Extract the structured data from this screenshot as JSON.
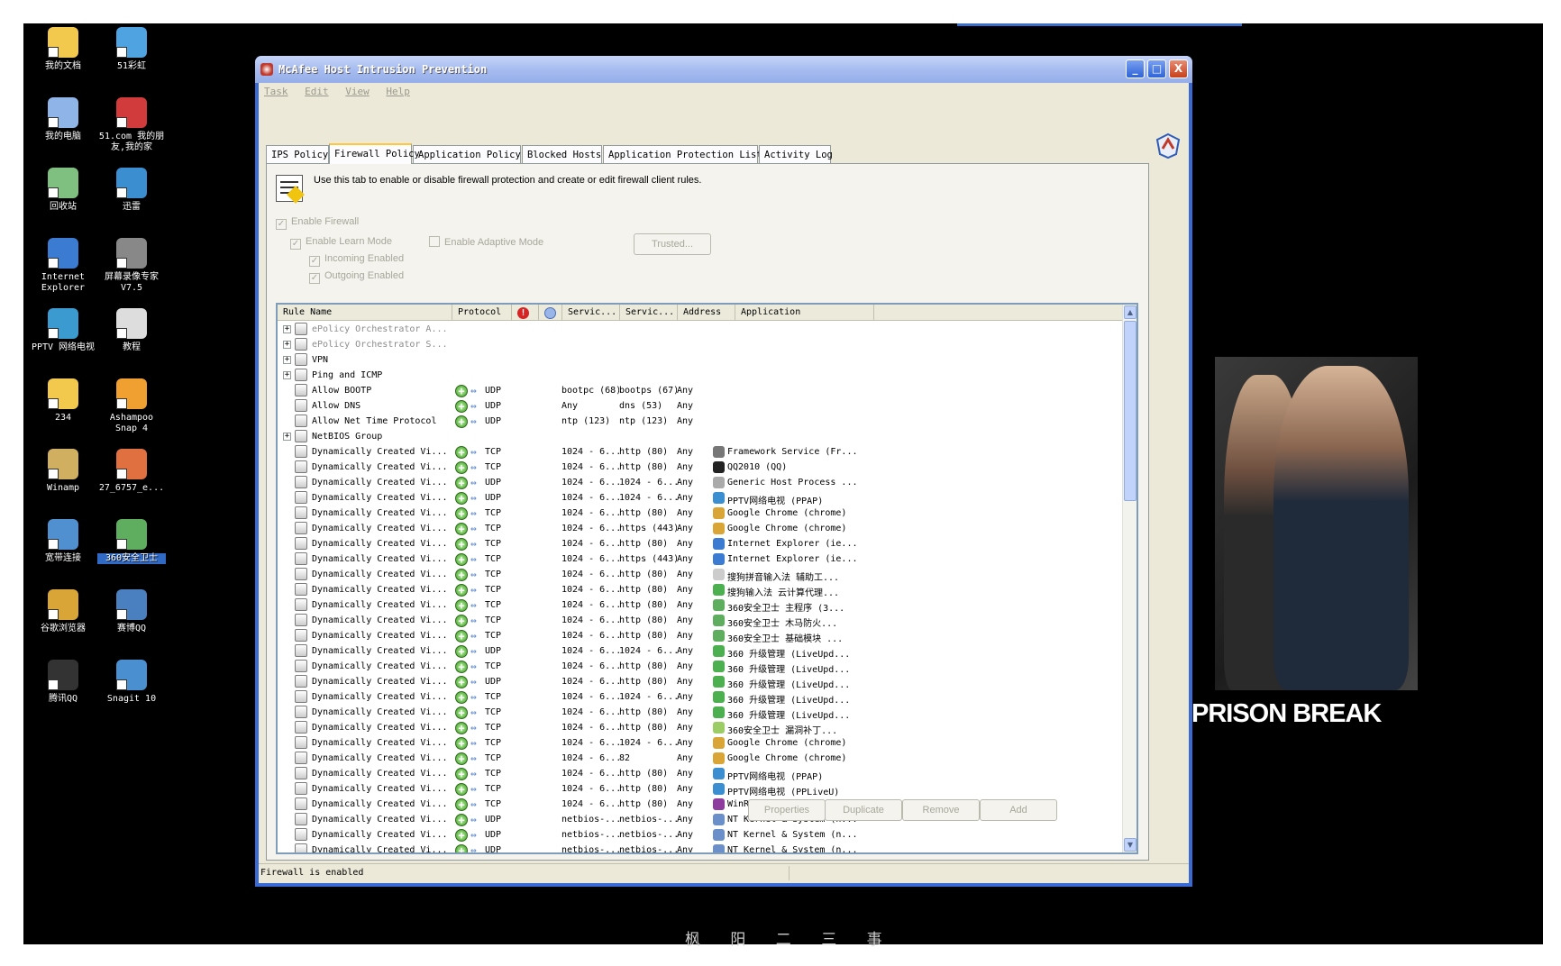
{
  "desktop": {
    "icons": [
      {
        "label": "我的文档",
        "color": "#f2c94c"
      },
      {
        "label": "51彩虹",
        "color": "#4fa3e0"
      },
      {
        "label": "我的电脑",
        "color": "#8fb4e8"
      },
      {
        "label": "51.com 我的朋友,我的家",
        "color": "#d13b3b"
      },
      {
        "label": "回收站",
        "color": "#7fbf7f"
      },
      {
        "label": "迅雷",
        "color": "#3b8fd1"
      },
      {
        "label": "Internet Explorer",
        "color": "#3b7bd1"
      },
      {
        "label": "屏幕录像专家 V7.5",
        "color": "#888888"
      },
      {
        "label": "PPTV 网络电视",
        "color": "#3b9bd1"
      },
      {
        "label": "教程",
        "color": "#dddddd"
      },
      {
        "label": "234",
        "color": "#f2c94c"
      },
      {
        "label": "Ashampoo Snap 4",
        "color": "#f0a030"
      },
      {
        "label": "Winamp",
        "color": "#d0b060"
      },
      {
        "label": "27_6757_e...",
        "color": "#e07040"
      },
      {
        "label": "宽带连接",
        "color": "#5090d0"
      },
      {
        "label": "360安全卫士",
        "color": "#5fae5f"
      },
      {
        "label": "谷歌浏览器",
        "color": "#d9a536"
      },
      {
        "label": "赛博QQ",
        "color": "#4a7fc0"
      },
      {
        "label": "腾讯QQ",
        "color": "#333333"
      },
      {
        "label": "Snagit 10",
        "color": "#4a8fd0"
      }
    ],
    "poster_title": "PRISON BREAK",
    "watermark": "枫 阳 二 三 事"
  },
  "window": {
    "title": "McAfee Host Intrusion Prevention",
    "buttons": {
      "minimize": "_",
      "maximize": "□",
      "close": "X"
    },
    "menu": [
      "Task",
      "Edit",
      "View",
      "Help"
    ],
    "tabs": [
      "IPS Policy",
      "Firewall Policy",
      "Application Policy",
      "Blocked Hosts",
      "Application Protection List",
      "Activity Log"
    ],
    "active_tab": "Firewall Policy",
    "description": "Use this tab to enable or disable firewall protection and create or edit firewall client rules.",
    "options": {
      "enable_firewall": "Enable Firewall",
      "enable_learn_mode": "Enable Learn Mode",
      "enable_adaptive_mode": "Enable Adaptive Mode",
      "incoming_enabled": "Incoming Enabled",
      "outgoing_enabled": "Outgoing Enabled",
      "trusted_button": "Trusted..."
    },
    "columns": [
      "Rule Name",
      "Protocol",
      "",
      "",
      "Servic...",
      "Servic...",
      "Address",
      "Application"
    ],
    "rows": [
      {
        "name": "ePolicy Orchestrator A...",
        "group": true,
        "grey": true,
        "protocol": "",
        "svc1": "",
        "svc2": "",
        "addr": "",
        "app": ""
      },
      {
        "name": "ePolicy Orchestrator S...",
        "group": true,
        "grey": true,
        "protocol": "",
        "svc1": "",
        "svc2": "",
        "addr": "",
        "app": ""
      },
      {
        "name": "VPN",
        "group": true,
        "grey": false,
        "protocol": "",
        "svc1": "",
        "svc2": "",
        "addr": "",
        "app": ""
      },
      {
        "name": "Ping and ICMP",
        "group": true,
        "grey": false,
        "protocol": "",
        "svc1": "",
        "svc2": "",
        "addr": "",
        "app": ""
      },
      {
        "name": "Allow BOOTP",
        "group": false,
        "grey": false,
        "protocol": "UDP",
        "svc1": "bootpc (68)",
        "svc2": "bootps (67)",
        "addr": "Any",
        "app": ""
      },
      {
        "name": "Allow DNS",
        "group": false,
        "grey": false,
        "protocol": "UDP",
        "svc1": "Any",
        "svc2": "dns (53)",
        "addr": "Any",
        "app": ""
      },
      {
        "name": "Allow Net Time Protocol",
        "group": false,
        "grey": false,
        "protocol": "UDP",
        "svc1": "ntp (123)",
        "svc2": "ntp (123)",
        "addr": "Any",
        "app": ""
      },
      {
        "name": "NetBIOS Group",
        "group": true,
        "grey": false,
        "protocol": "",
        "svc1": "",
        "svc2": "",
        "addr": "",
        "app": ""
      },
      {
        "name": "Dynamically Created Vi...",
        "group": false,
        "grey": false,
        "protocol": "TCP",
        "svc1": "1024 - 6...",
        "svc2": "http (80)",
        "addr": "Any",
        "app": "Framework Service (Fr...",
        "app_color": "#777777"
      },
      {
        "name": "Dynamically Created Vi...",
        "group": false,
        "grey": false,
        "protocol": "TCP",
        "svc1": "1024 - 6...",
        "svc2": "http (80)",
        "addr": "Any",
        "app": "QQ2010 (QQ)",
        "app_color": "#222222"
      },
      {
        "name": "Dynamically Created Vi...",
        "group": false,
        "grey": false,
        "protocol": "UDP",
        "svc1": "1024 - 6...",
        "svc2": "1024 - 6...",
        "addr": "Any",
        "app": "Generic Host Process ...",
        "app_color": "#aaaaaa"
      },
      {
        "name": "Dynamically Created Vi...",
        "group": false,
        "grey": false,
        "protocol": "UDP",
        "svc1": "1024 - 6...",
        "svc2": "1024 - 6...",
        "addr": "Any",
        "app": "PPTV网络电视 (PPAP)",
        "app_color": "#3b8fd1"
      },
      {
        "name": "Dynamically Created Vi...",
        "group": false,
        "grey": false,
        "protocol": "TCP",
        "svc1": "1024 - 6...",
        "svc2": "http (80)",
        "addr": "Any",
        "app": "Google Chrome (chrome)",
        "app_color": "#d9a536"
      },
      {
        "name": "Dynamically Created Vi...",
        "group": false,
        "grey": false,
        "protocol": "TCP",
        "svc1": "1024 - 6...",
        "svc2": "https (443)",
        "addr": "Any",
        "app": "Google Chrome (chrome)",
        "app_color": "#d9a536"
      },
      {
        "name": "Dynamically Created Vi...",
        "group": false,
        "grey": false,
        "protocol": "TCP",
        "svc1": "1024 - 6...",
        "svc2": "http (80)",
        "addr": "Any",
        "app": "Internet Explorer (ie...",
        "app_color": "#3b7bd1"
      },
      {
        "name": "Dynamically Created Vi...",
        "group": false,
        "grey": false,
        "protocol": "TCP",
        "svc1": "1024 - 6...",
        "svc2": "https (443)",
        "addr": "Any",
        "app": "Internet Explorer (ie...",
        "app_color": "#3b7bd1"
      },
      {
        "name": "Dynamically Created Vi...",
        "group": false,
        "grey": false,
        "protocol": "TCP",
        "svc1": "1024 - 6...",
        "svc2": "http (80)",
        "addr": "Any",
        "app": "搜狗拼音输入法 辅助工...",
        "app_color": "#cccccc"
      },
      {
        "name": "Dynamically Created Vi...",
        "group": false,
        "grey": false,
        "protocol": "TCP",
        "svc1": "1024 - 6...",
        "svc2": "http (80)",
        "addr": "Any",
        "app": "搜狗输入法 云计算代理...",
        "app_color": "#4caf50"
      },
      {
        "name": "Dynamically Created Vi...",
        "group": false,
        "grey": false,
        "protocol": "TCP",
        "svc1": "1024 - 6...",
        "svc2": "http (80)",
        "addr": "Any",
        "app": "360安全卫士 主程序 (3...",
        "app_color": "#5fae5f"
      },
      {
        "name": "Dynamically Created Vi...",
        "group": false,
        "grey": false,
        "protocol": "TCP",
        "svc1": "1024 - 6...",
        "svc2": "http (80)",
        "addr": "Any",
        "app": "360安全卫士 木马防火...",
        "app_color": "#5fae5f"
      },
      {
        "name": "Dynamically Created Vi...",
        "group": false,
        "grey": false,
        "protocol": "TCP",
        "svc1": "1024 - 6...",
        "svc2": "http (80)",
        "addr": "Any",
        "app": "360安全卫士 基础模块 ...",
        "app_color": "#5fae5f"
      },
      {
        "name": "Dynamically Created Vi...",
        "group": false,
        "grey": false,
        "protocol": "UDP",
        "svc1": "1024 - 6...",
        "svc2": "1024 - 6...",
        "addr": "Any",
        "app": "360 升级管理 (LiveUpd...",
        "app_color": "#4caf50"
      },
      {
        "name": "Dynamically Created Vi...",
        "group": false,
        "grey": false,
        "protocol": "TCP",
        "svc1": "1024 - 6...",
        "svc2": "http (80)",
        "addr": "Any",
        "app": "360 升级管理 (LiveUpd...",
        "app_color": "#4caf50"
      },
      {
        "name": "Dynamically Created Vi...",
        "group": false,
        "grey": false,
        "protocol": "UDP",
        "svc1": "1024 - 6...",
        "svc2": "http (80)",
        "addr": "Any",
        "app": "360 升级管理 (LiveUpd...",
        "app_color": "#4caf50"
      },
      {
        "name": "Dynamically Created Vi...",
        "group": false,
        "grey": false,
        "protocol": "TCP",
        "svc1": "1024 - 6...",
        "svc2": "1024 - 6...",
        "addr": "Any",
        "app": "360 升级管理 (LiveUpd...",
        "app_color": "#4caf50"
      },
      {
        "name": "Dynamically Created Vi...",
        "group": false,
        "grey": false,
        "protocol": "TCP",
        "svc1": "1024 - 6...",
        "svc2": "http (80)",
        "addr": "Any",
        "app": "360 升级管理 (LiveUpd...",
        "app_color": "#4caf50"
      },
      {
        "name": "Dynamically Created Vi...",
        "group": false,
        "grey": false,
        "protocol": "TCP",
        "svc1": "1024 - 6...",
        "svc2": "http (80)",
        "addr": "Any",
        "app": "360安全卫士 漏洞补丁...",
        "app_color": "#9ccc65"
      },
      {
        "name": "Dynamically Created Vi...",
        "group": false,
        "grey": false,
        "protocol": "TCP",
        "svc1": "1024 - 6...",
        "svc2": "1024 - 6...",
        "addr": "Any",
        "app": "Google Chrome (chrome)",
        "app_color": "#d9a536"
      },
      {
        "name": "Dynamically Created Vi...",
        "group": false,
        "grey": false,
        "protocol": "TCP",
        "svc1": "1024 - 6...",
        "svc2": "82",
        "addr": "Any",
        "app": "Google Chrome (chrome)",
        "app_color": "#d9a536"
      },
      {
        "name": "Dynamically Created Vi...",
        "group": false,
        "grey": false,
        "protocol": "TCP",
        "svc1": "1024 - 6...",
        "svc2": "http (80)",
        "addr": "Any",
        "app": "PPTV网络电视 (PPAP)",
        "app_color": "#3b8fd1"
      },
      {
        "name": "Dynamically Created Vi...",
        "group": false,
        "grey": false,
        "protocol": "TCP",
        "svc1": "1024 - 6...",
        "svc2": "http (80)",
        "addr": "Any",
        "app": "PPTV网络电视 (PPLiveU)",
        "app_color": "#3b8fd1"
      },
      {
        "name": "Dynamically Created Vi...",
        "group": false,
        "grey": false,
        "protocol": "TCP",
        "svc1": "1024 - 6...",
        "svc2": "http (80)",
        "addr": "Any",
        "app": "WinRAR",
        "app_color": "#8e3c9e"
      },
      {
        "name": "Dynamically Created Vi...",
        "group": false,
        "grey": false,
        "protocol": "UDP",
        "svc1": "netbios-...",
        "svc2": "netbios-...",
        "addr": "Any",
        "app": "NT Kernel & System (n...",
        "app_color": "#6a8fc9"
      },
      {
        "name": "Dynamically Created Vi...",
        "group": false,
        "grey": false,
        "protocol": "UDP",
        "svc1": "netbios-...",
        "svc2": "netbios-...",
        "addr": "Any",
        "app": "NT Kernel & System (n...",
        "app_color": "#6a8fc9"
      },
      {
        "name": "Dynamically Created Vi...",
        "group": false,
        "grey": false,
        "protocol": "UDP",
        "svc1": "netbios-...",
        "svc2": "netbios-...",
        "addr": "Any",
        "app": "NT Kernel & System (n...",
        "app_color": "#6a8fc9"
      }
    ],
    "bottom_buttons": {
      "properties": "Properties",
      "duplicate": "Duplicate",
      "remove": "Remove",
      "add": "Add"
    },
    "status": "Firewall is enabled"
  }
}
